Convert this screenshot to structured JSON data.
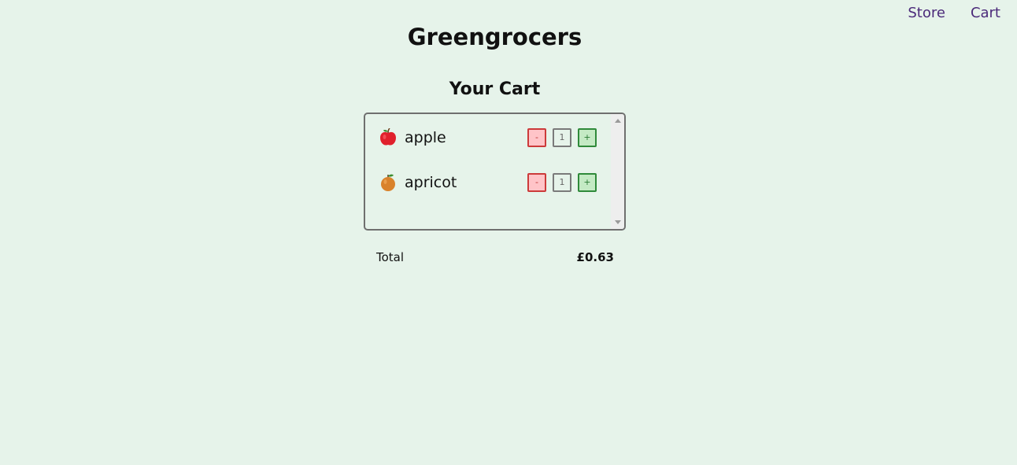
{
  "nav": {
    "store_label": "Store",
    "cart_label": "Cart"
  },
  "header": {
    "title": "Greengrocers"
  },
  "cart": {
    "title": "Your Cart",
    "items": [
      {
        "name": "apple",
        "icon": "apple-icon",
        "quantity": "1",
        "minus_label": "-",
        "plus_label": "+"
      },
      {
        "name": "apricot",
        "icon": "apricot-icon",
        "quantity": "1",
        "minus_label": "-",
        "plus_label": "+"
      }
    ],
    "total_label": "Total",
    "total_value": "£0.63"
  },
  "colors": {
    "background": "#e6f3ea",
    "nav_link": "#4b2a7a",
    "minus_border": "#cc3a3a",
    "minus_fill": "#ffc4c8",
    "plus_border": "#2f8a3a",
    "plus_fill": "#c4eac4"
  }
}
